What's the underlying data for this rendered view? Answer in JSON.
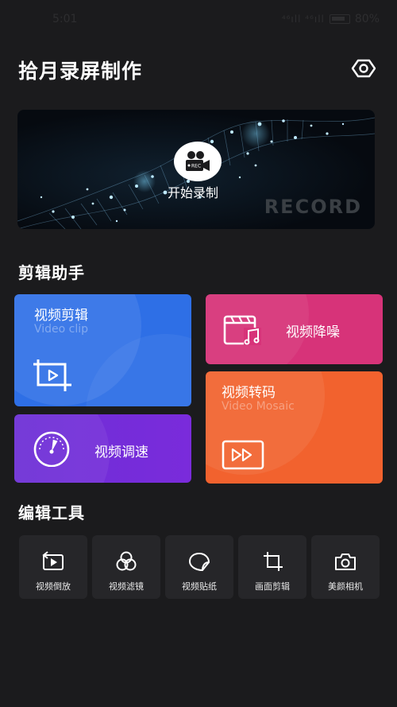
{
  "status_bar": {
    "time": "5:01",
    "signal": "⁴⁶ıll ⁴⁶ıll",
    "battery": "80%"
  },
  "header": {
    "title": "拾月录屏制作",
    "settings_icon": "hexagon-eye-icon"
  },
  "banner": {
    "record_label": "开始录制",
    "watermark": "RECORD",
    "icon": "video-camera-icon"
  },
  "sections": {
    "assistant": "剪辑助手",
    "tools": "编辑工具"
  },
  "cards": {
    "clip": {
      "title": "视频剪辑",
      "subtitle": "Video clip",
      "icon": "crop-icon"
    },
    "speed": {
      "title": "视频调速",
      "icon": "speedometer-icon"
    },
    "noise": {
      "title": "视频降噪",
      "icon": "music-clapper-icon"
    },
    "transcode": {
      "title": "视频转码",
      "subtitle": "Video Mosaic",
      "icon": "fast-forward-icon"
    }
  },
  "tools": [
    {
      "label": "视频倒放",
      "icon": "rewind-play-icon"
    },
    {
      "label": "视频滤镜",
      "icon": "filter-circles-icon"
    },
    {
      "label": "视频贴纸",
      "icon": "sticker-icon"
    },
    {
      "label": "画面剪辑",
      "icon": "crop-frame-icon"
    },
    {
      "label": "美颜相机",
      "icon": "camera-icon"
    }
  ],
  "colors": {
    "background": "#1b1b1d",
    "clip_card": "#2e6fe6",
    "speed_card": "#7a2bdb",
    "noise_card": "#d73379",
    "transcode_card": "#f2622e",
    "tool_tile": "#262629"
  }
}
